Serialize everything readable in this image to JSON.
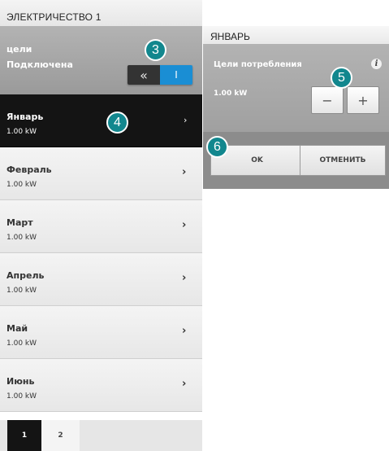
{
  "panel": {
    "title": "ЭЛЕКТРИЧЕСТВО 1",
    "goals_label": "цели",
    "goals_status": "Подключена",
    "toggle_back_icon": "«",
    "toggle_on_icon": "I"
  },
  "months": [
    {
      "name": "Январь",
      "value": "1.00 kW",
      "selected": true
    },
    {
      "name": "Февраль",
      "value": "1.00 kW"
    },
    {
      "name": "Март",
      "value": "1.00 kW"
    },
    {
      "name": "Апрель",
      "value": "1.00 kW"
    },
    {
      "name": "Май",
      "value": "1.00 kW"
    },
    {
      "name": "Июнь",
      "value": "1.00 kW"
    }
  ],
  "chevron": "›",
  "pager": {
    "pages": [
      "1",
      "2"
    ],
    "current": "1"
  },
  "dialog": {
    "title": "ЯНВАРЬ",
    "label": "Цели потребления",
    "info_icon": "i",
    "value": "1.00 kW",
    "minus": "−",
    "plus": "+",
    "ok": "OK",
    "cancel": "ОТМЕНИТЬ"
  },
  "badges": {
    "b3": "3",
    "b4": "4",
    "b5": "5",
    "b6": "6"
  },
  "colors": {
    "accent": "#1a8ed4",
    "badge": "#12878e",
    "selected_row": "#141414"
  }
}
